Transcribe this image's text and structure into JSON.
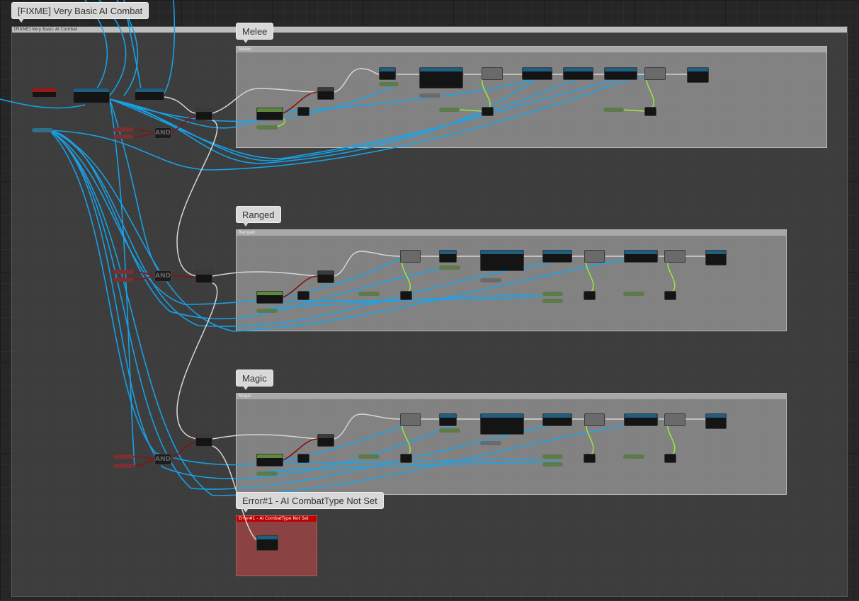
{
  "titles": {
    "main": "[FIXME] Very Basic AI Combat",
    "main_header": "[FIXME] Very Basic AI Combat",
    "melee": "Melee",
    "melee_header": "Melee",
    "ranged": "Ranged",
    "ranged_header": "Ranged",
    "magic": "Magic",
    "magic_header": "Magic",
    "error": "Error#1 - AI CombatType Not Set",
    "error_header": "Error#1 - AI CombatType Not Set"
  },
  "nodes": {
    "and": "AND"
  },
  "colors": {
    "exec_wire": "#d6d6d6",
    "object_wire": "#14a6f0",
    "bool_wire": "#8a1010",
    "float_wire": "#9ae83a",
    "event_header": "#a01515",
    "function_header": "#1e5f80",
    "pure_header": "#5c8a3c"
  }
}
